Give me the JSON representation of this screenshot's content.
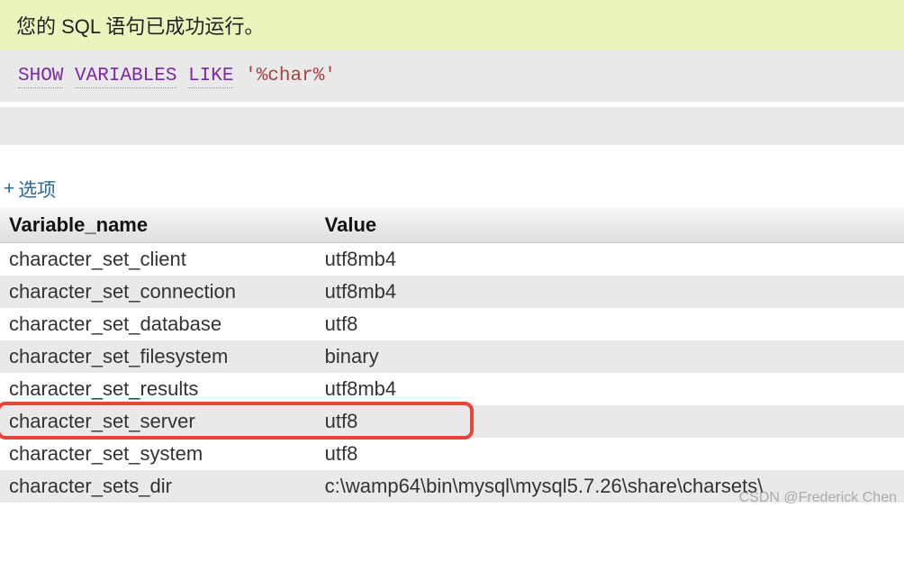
{
  "banner": {
    "message": "您的 SQL 语句已成功运行。"
  },
  "query": {
    "kw1": "SHOW",
    "kw2": "VARIABLES",
    "kw3": "LIKE",
    "str": "'%char%'"
  },
  "options": {
    "plus": "+",
    "label": "选项"
  },
  "table": {
    "headers": {
      "name": "Variable_name",
      "value": "Value"
    },
    "rows": [
      {
        "name": "character_set_client",
        "value": "utf8mb4"
      },
      {
        "name": "character_set_connection",
        "value": "utf8mb4"
      },
      {
        "name": "character_set_database",
        "value": "utf8"
      },
      {
        "name": "character_set_filesystem",
        "value": "binary"
      },
      {
        "name": "character_set_results",
        "value": "utf8mb4"
      },
      {
        "name": "character_set_server",
        "value": "utf8"
      },
      {
        "name": "character_set_system",
        "value": "utf8"
      },
      {
        "name": "character_sets_dir",
        "value": "c:\\wamp64\\bin\\mysql\\mysql5.7.26\\share\\charsets\\"
      }
    ],
    "highlight_index": 5
  },
  "watermark": "CSDN @Frederick Chen"
}
